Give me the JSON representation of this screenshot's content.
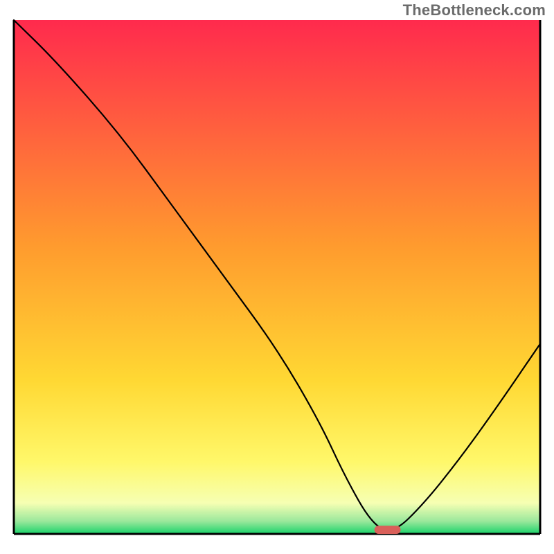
{
  "watermark": "TheBottleneck.com",
  "chart_data": {
    "type": "line",
    "title": "",
    "xlabel": "",
    "ylabel": "",
    "xlim": [
      0,
      100
    ],
    "ylim": [
      0,
      100
    ],
    "grid": false,
    "legend": false,
    "background_gradient_stops": [
      {
        "offset": 0,
        "color": "#ff2a4d"
      },
      {
        "offset": 0.44,
        "color": "#ff9b2e"
      },
      {
        "offset": 0.7,
        "color": "#ffd833"
      },
      {
        "offset": 0.86,
        "color": "#fff86a"
      },
      {
        "offset": 0.94,
        "color": "#f6ffb3"
      },
      {
        "offset": 0.975,
        "color": "#9be89c"
      },
      {
        "offset": 1.0,
        "color": "#19d36a"
      }
    ],
    "series": [
      {
        "name": "bottleneck-curve",
        "color": "#000000",
        "stroke_width": 2.2,
        "x": [
          0,
          8,
          20,
          30,
          40,
          50,
          58,
          63,
          68,
          72,
          78,
          85,
          92,
          100
        ],
        "values": [
          100,
          92,
          78,
          64,
          50,
          36,
          22,
          11,
          2,
          0,
          6,
          15,
          25,
          37
        ]
      }
    ],
    "marker": {
      "name": "optimal-point",
      "x": 71,
      "y": 0.8,
      "width": 5,
      "height": 1.6,
      "color": "#d9605a"
    },
    "annotations": []
  }
}
